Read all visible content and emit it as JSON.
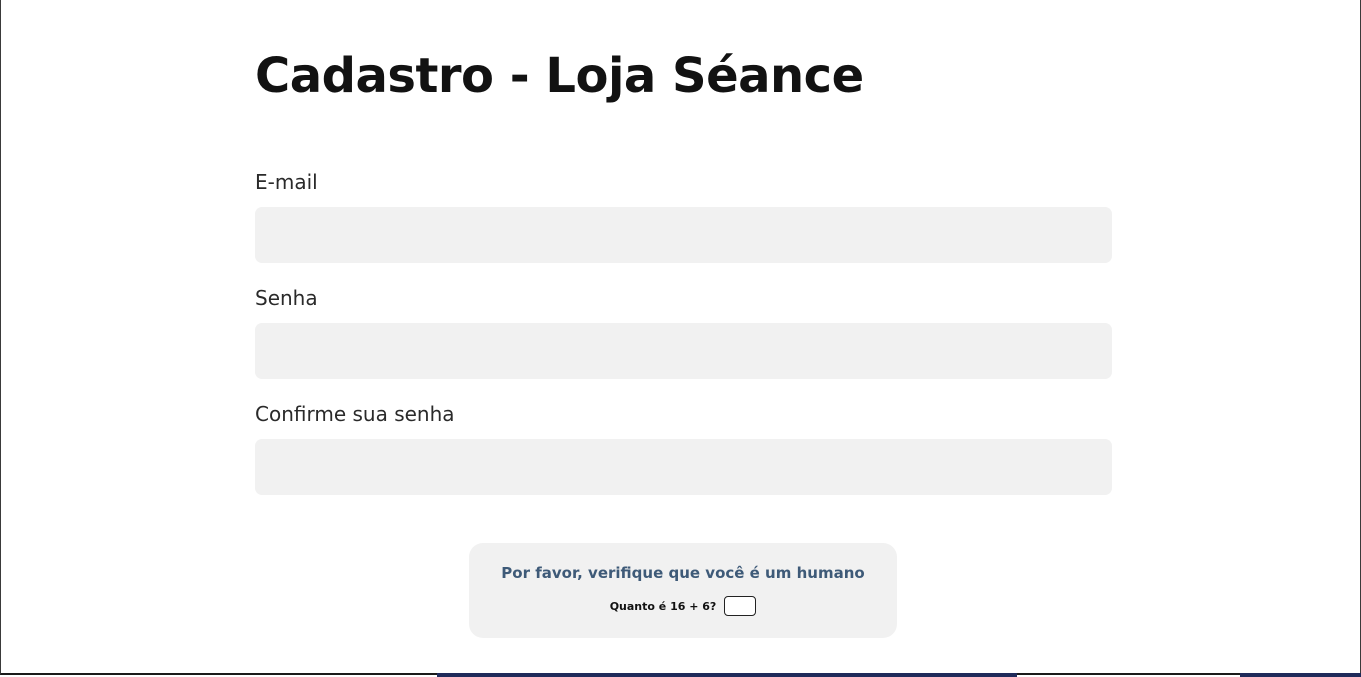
{
  "page": {
    "title": "Cadastro - Loja Séance"
  },
  "form": {
    "email": {
      "label": "E-mail",
      "value": ""
    },
    "password": {
      "label": "Senha",
      "value": ""
    },
    "confirm_password": {
      "label": "Confirme sua senha",
      "value": ""
    }
  },
  "captcha": {
    "title": "Por favor, verifique que você é um humano",
    "question": "Quanto é 16 + 6?",
    "answer": ""
  },
  "colors": {
    "input_background": "#f1f1f1",
    "captcha_title": "#3e5a78",
    "heading": "#121212"
  }
}
